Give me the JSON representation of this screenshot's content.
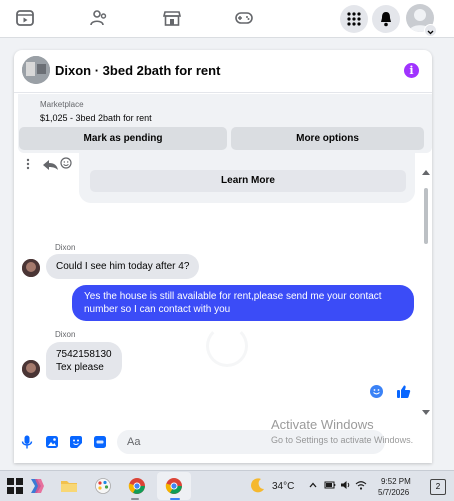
{
  "chat": {
    "title": "Dixon · 3bed 2bath for rent",
    "info_icon": "i",
    "marketplace": {
      "caption": "Marketplace",
      "item": "$1,025 - 3bed 2bath for rent",
      "mark_pending_label": "Mark as pending",
      "more_options_label": "More options"
    },
    "learn_more_label": "Learn More",
    "messages": [
      {
        "sender": "Dixon",
        "text": "Could I see him today after 4?"
      },
      {
        "sender": "me",
        "text": "Yes the house is still available for rent,please send me your contact number so I can contact with you"
      },
      {
        "sender": "Dixon",
        "text": "7542158130",
        "text2": "Tex please"
      }
    ],
    "composer_placeholder": "Aa"
  },
  "watermark": {
    "line1": "Activate Windows",
    "line2": "Go to Settings to activate Windows."
  },
  "taskbar": {
    "temperature": "34°C",
    "time": "9:52 PM",
    "date": "5/7/2026",
    "notification_count": "2"
  },
  "colors": {
    "outgoing_bubble": "#3b4cf7",
    "accent_info": "#a033ff",
    "messenger_blue": "#0866ff"
  },
  "icons": [
    "video-icon",
    "groups-icon",
    "marketplace-icon",
    "gaming-icon",
    "menu-grid-icon",
    "notifications-icon",
    "profile-avatar",
    "microphone-icon",
    "image-icon",
    "sticker-icon",
    "gif-icon",
    "emoji-icon",
    "like-icon"
  ]
}
